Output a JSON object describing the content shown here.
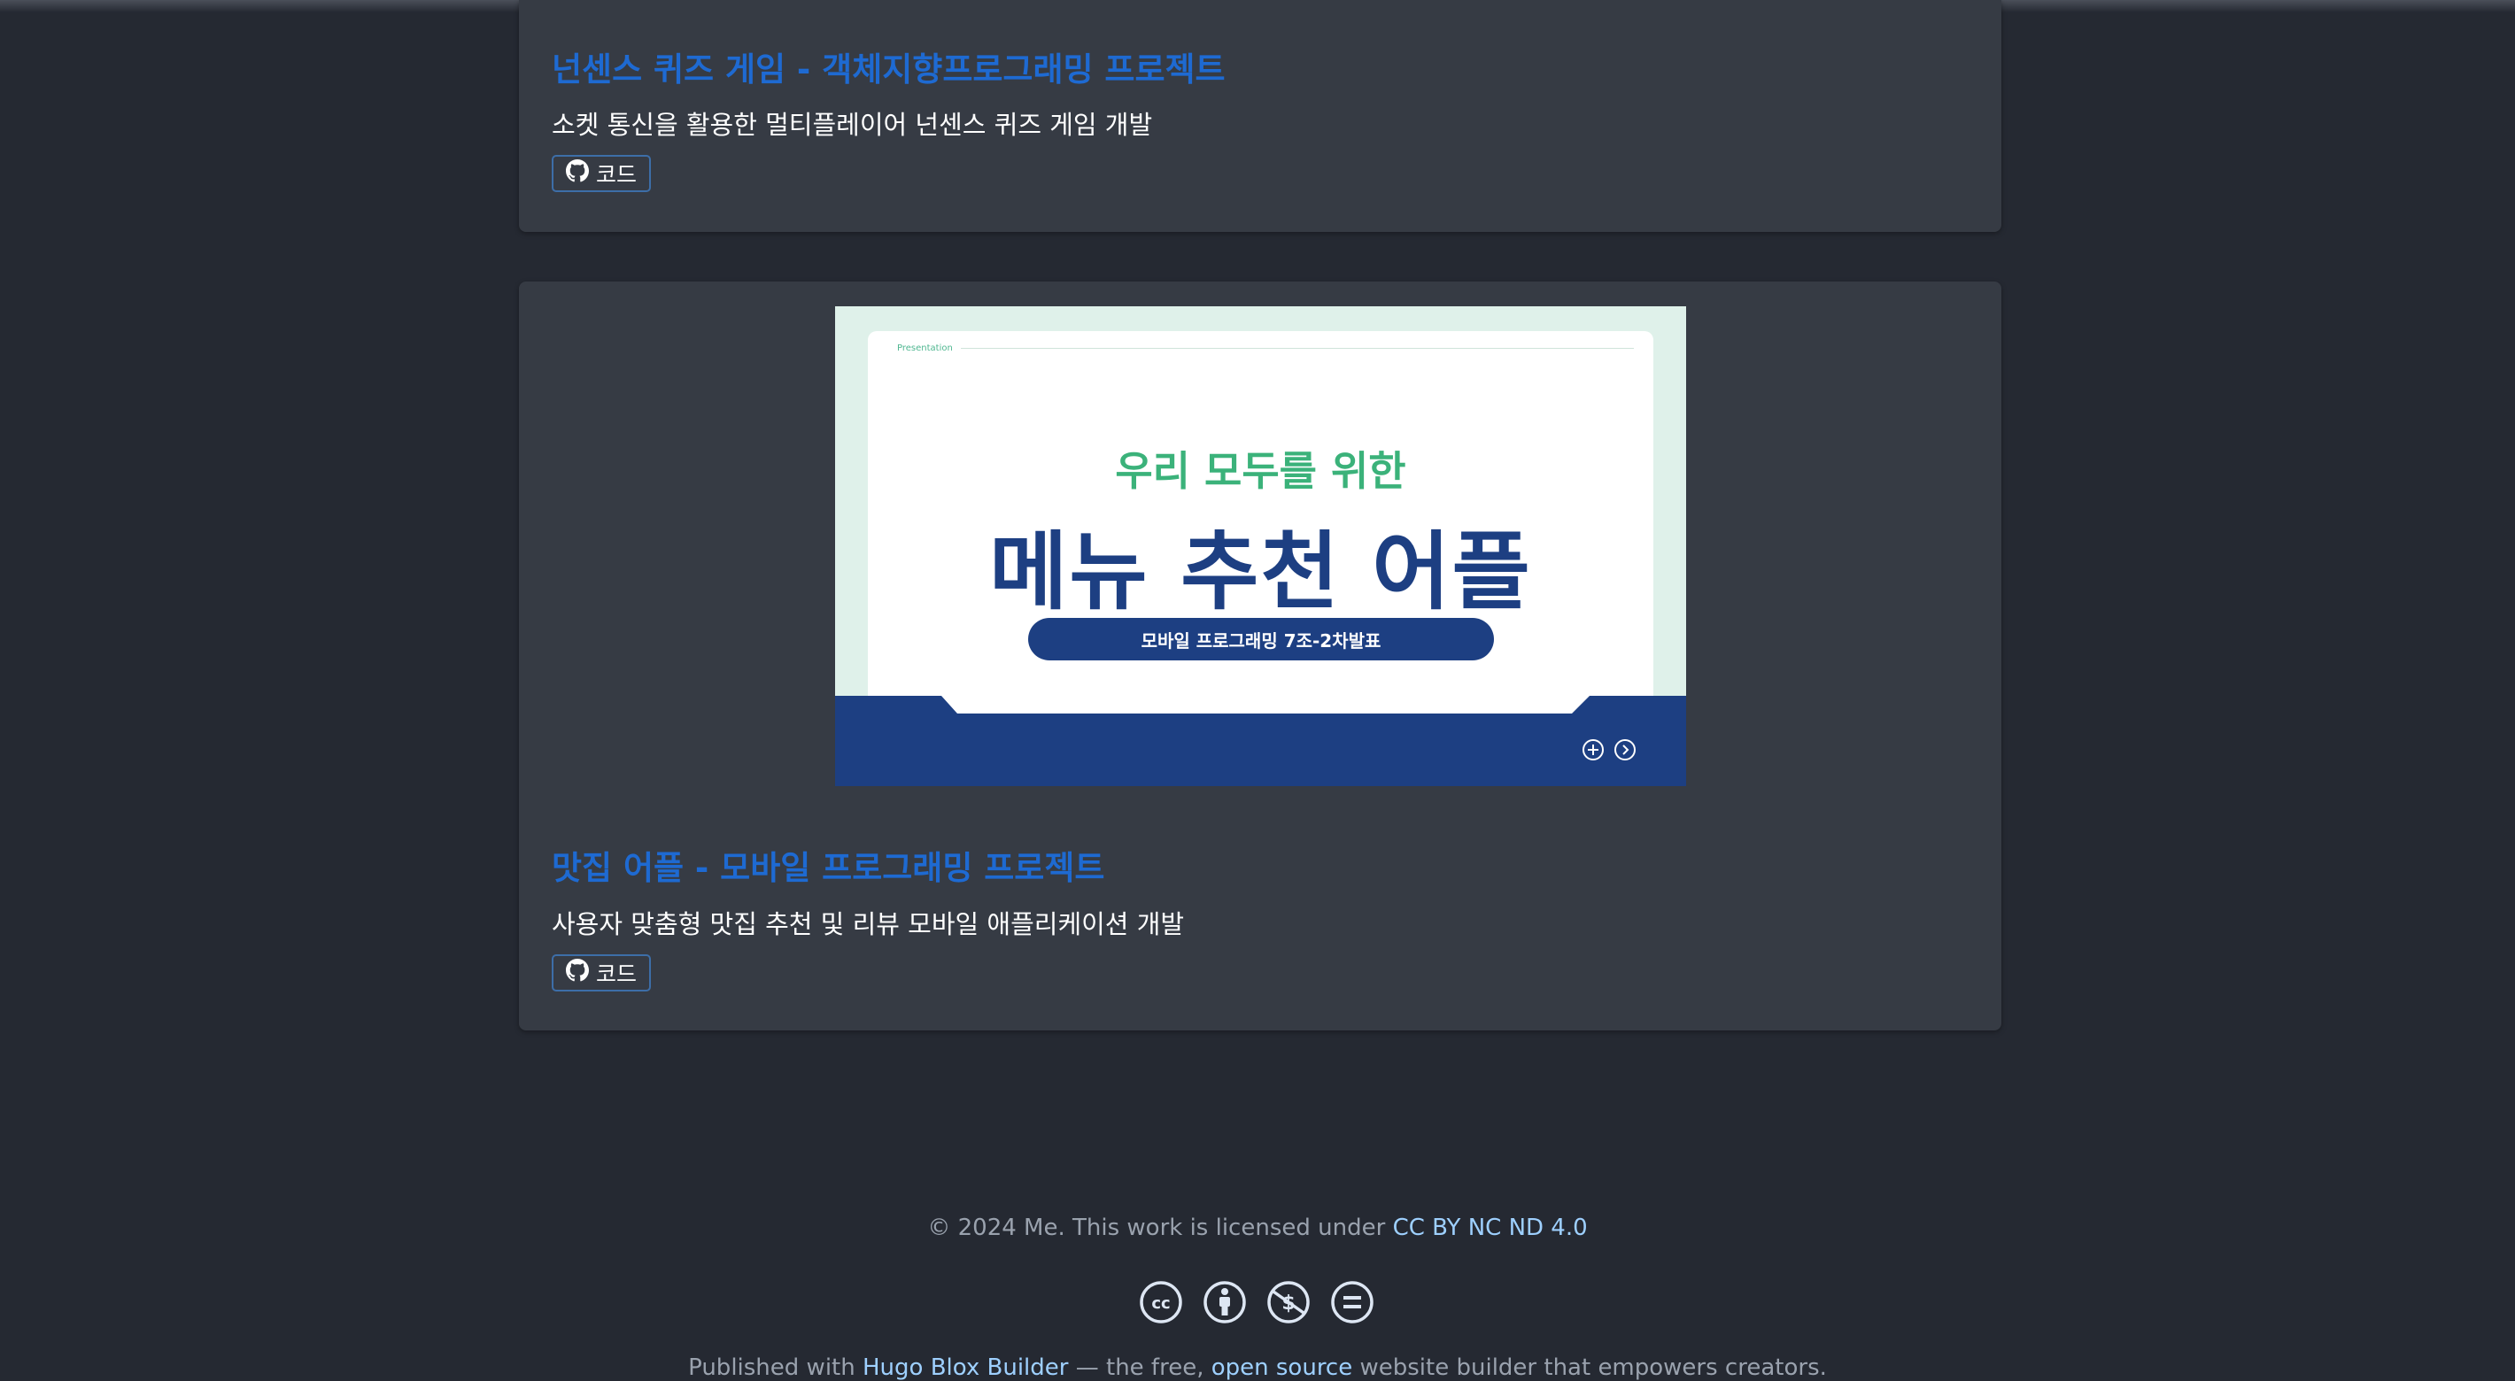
{
  "projects": [
    {
      "title": "넌센스 퀴즈 게임 - 객체지향프로그래밍 프로젝트",
      "description": "소켓 통신을 활용한 멀티플레이어 넌센스 퀴즈 게임 개발",
      "code_label": "코드"
    },
    {
      "title": "맛집 어플 - 모바일 프로그래밍 프로젝트",
      "description": "사용자 맞춤형 맛집 추천 및 리뷰 모바일 애플리케이션 개발",
      "code_label": "코드",
      "thumbnail": {
        "corner_label": "Presentation",
        "subheading": "우리 모두를 위한",
        "heading": "메뉴 추천 어플",
        "badge": "모바일 프로그래밍 7조-2차발표"
      }
    }
  ],
  "footer": {
    "copyright_prefix": "© 2024 Me. This work is licensed under",
    "license_link": "CC BY NC ND 4.0",
    "published_prefix": "Published with",
    "builder_link": "Hugo Blox Builder",
    "published_middle": "— the free,",
    "open_source_link": "open source",
    "published_suffix": "website builder that empowers creators.",
    "license_icons": [
      "cc-icon",
      "by-icon",
      "nc-icon",
      "nd-icon"
    ]
  },
  "colors": {
    "background": "#252932",
    "card": "#363b44",
    "title_link": "#1e6ad2",
    "footer_link": "#9ed0ff"
  }
}
